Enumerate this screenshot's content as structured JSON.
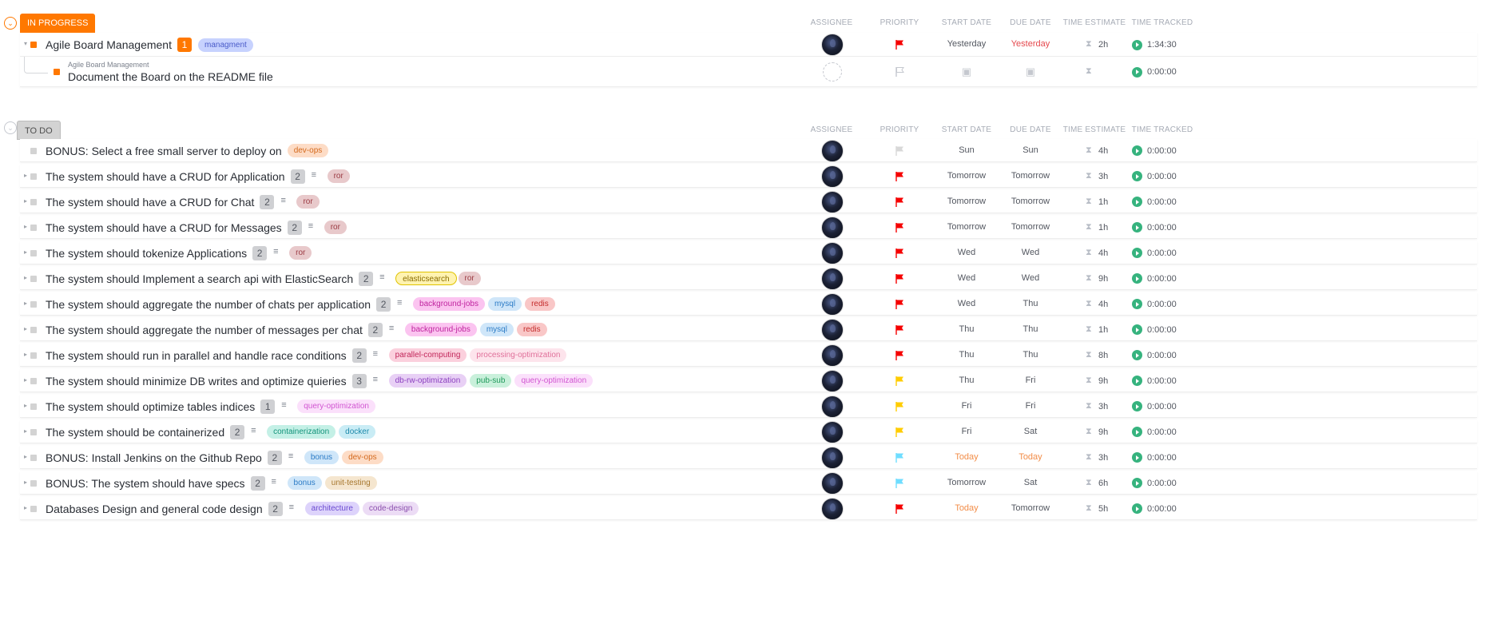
{
  "columns": {
    "assignee": "ASSIGNEE",
    "priority": "PRIORITY",
    "start_date": "START DATE",
    "due_date": "DUE DATE",
    "time_estimate": "TIME ESTIMATE",
    "time_tracked": "TIME TRACKED"
  },
  "colors": {
    "in_progress": "#ff7800",
    "todo": "#d3d3d3",
    "urgent_flag": "#f50000",
    "high_flag": "#ffcc00",
    "low_flag": "#6fddff",
    "none_flag": "#d8d8d8",
    "overdue": "#e5484d",
    "today": "#f28d48"
  },
  "groups": [
    {
      "status": "IN PROGRESS",
      "tasks": [
        {
          "title": "Agile Board Management",
          "subtask_count": "1",
          "tags": [
            {
              "label": "managment",
              "bg": "#c7d2fe",
              "fg": "#4a5bc9"
            }
          ],
          "assignee": "avatar",
          "priority": "urgent",
          "start": "Yesterday",
          "due": "Yesterday",
          "due_color": "overdue",
          "estimate": "2h",
          "tracked": "1:34:30"
        },
        {
          "parent": "Agile Board Management",
          "title": "Document the Board on the README file",
          "assignee": "empty",
          "priority": "empty",
          "tracked": "0:00:00"
        }
      ]
    },
    {
      "status": "TO DO",
      "tasks": [
        {
          "title": "BONUS: Select a free small server to deploy on",
          "tags": [
            {
              "label": "dev-ops",
              "bg": "#fddcc6",
              "fg": "#d46a1e"
            }
          ],
          "priority": "none",
          "start": "Sun",
          "due": "Sun",
          "estimate": "4h",
          "tracked": "0:00:00"
        },
        {
          "title": "The system should have a CRUD for Application",
          "subtask_count": "2",
          "tags": [
            {
              "label": "ror",
              "bg": "#e8c9cb",
              "fg": "#9b3a42"
            }
          ],
          "priority": "urgent",
          "start": "Tomorrow",
          "due": "Tomorrow",
          "estimate": "3h",
          "tracked": "0:00:00"
        },
        {
          "title": "The system should have a CRUD for Chat",
          "subtask_count": "2",
          "tags": [
            {
              "label": "ror",
              "bg": "#e8c9cb",
              "fg": "#9b3a42"
            }
          ],
          "priority": "urgent",
          "start": "Tomorrow",
          "due": "Tomorrow",
          "estimate": "1h",
          "tracked": "0:00:00"
        },
        {
          "title": "The system should have a CRUD for Messages",
          "subtask_count": "2",
          "tags": [
            {
              "label": "ror",
              "bg": "#e8c9cb",
              "fg": "#9b3a42"
            }
          ],
          "priority": "urgent",
          "start": "Tomorrow",
          "due": "Tomorrow",
          "estimate": "1h",
          "tracked": "0:00:00"
        },
        {
          "title": "The system should tokenize Applications",
          "subtask_count": "2",
          "tags": [
            {
              "label": "ror",
              "bg": "#e8c9cb",
              "fg": "#9b3a42"
            }
          ],
          "priority": "urgent",
          "start": "Wed",
          "due": "Wed",
          "estimate": "4h",
          "tracked": "0:00:00"
        },
        {
          "title": "The system should Implement a search api with ElasticSearch",
          "subtask_count": "2",
          "tags": [
            {
              "label": "elasticsearch",
              "bg": "#fff3b0",
              "fg": "#8a6d00",
              "border": "#e0c300"
            },
            {
              "label": "ror",
              "bg": "#e8c9cb",
              "fg": "#9b3a42"
            }
          ],
          "priority": "urgent",
          "start": "Wed",
          "due": "Wed",
          "estimate": "9h",
          "tracked": "0:00:00"
        },
        {
          "title": "The system should aggregate the number of chats per application",
          "subtask_count": "2",
          "tags": [
            {
              "label": "background-jobs",
              "bg": "#fbc4f0",
              "fg": "#c0249f"
            },
            {
              "label": "mysql",
              "bg": "#cfe6f9",
              "fg": "#2b7bc6"
            },
            {
              "label": "redis",
              "bg": "#f9c7c7",
              "fg": "#c42b2b"
            }
          ],
          "priority": "urgent",
          "start": "Wed",
          "due": "Thu",
          "estimate": "4h",
          "tracked": "0:00:00"
        },
        {
          "title": "The system should aggregate the number of messages per chat",
          "subtask_count": "2",
          "tags": [
            {
              "label": "background-jobs",
              "bg": "#fbc4f0",
              "fg": "#c0249f"
            },
            {
              "label": "mysql",
              "bg": "#cfe6f9",
              "fg": "#2b7bc6"
            },
            {
              "label": "redis",
              "bg": "#f9c7c7",
              "fg": "#c42b2b"
            }
          ],
          "priority": "urgent",
          "start": "Thu",
          "due": "Thu",
          "estimate": "1h",
          "tracked": "0:00:00"
        },
        {
          "title": "The system should run in parallel and handle race conditions",
          "subtask_count": "2",
          "tags": [
            {
              "label": "parallel-computing",
              "bg": "#fbd0dd",
              "fg": "#c2265a"
            },
            {
              "label": "processing-optimization",
              "bg": "#fde4ec",
              "fg": "#e0709a"
            }
          ],
          "priority": "urgent",
          "start": "Thu",
          "due": "Thu",
          "estimate": "8h",
          "tracked": "0:00:00"
        },
        {
          "title": "The system should minimize DB writes and optimize quieries",
          "subtask_count": "3",
          "tags": [
            {
              "label": "db-rw-optimization",
              "bg": "#e8d0f5",
              "fg": "#8b3fbf"
            },
            {
              "label": "pub-sub",
              "bg": "#c9f0db",
              "fg": "#1f9a5a"
            },
            {
              "label": "query-optimization",
              "bg": "#fbe0fb",
              "fg": "#d155d1"
            }
          ],
          "priority": "high",
          "start": "Thu",
          "due": "Fri",
          "estimate": "9h",
          "tracked": "0:00:00"
        },
        {
          "title": "The system should optimize tables indices",
          "subtask_count": "1",
          "tags": [
            {
              "label": "query-optimization",
              "bg": "#fbe0fb",
              "fg": "#d155d1"
            }
          ],
          "priority": "high",
          "start": "Fri",
          "due": "Fri",
          "estimate": "3h",
          "tracked": "0:00:00"
        },
        {
          "title": "The system should be containerized",
          "subtask_count": "2",
          "tags": [
            {
              "label": "containerization",
              "bg": "#c4f0e6",
              "fg": "#12937a"
            },
            {
              "label": "docker",
              "bg": "#c9ecf5",
              "fg": "#1d8aab"
            }
          ],
          "priority": "high",
          "start": "Fri",
          "due": "Sat",
          "estimate": "9h",
          "tracked": "0:00:00"
        },
        {
          "title": "BONUS: Install Jenkins on the Github Repo",
          "subtask_count": "2",
          "tags": [
            {
              "label": "bonus",
              "bg": "#cfe6f9",
              "fg": "#2b7bc6"
            },
            {
              "label": "dev-ops",
              "bg": "#fddcc6",
              "fg": "#d46a1e"
            }
          ],
          "priority": "low",
          "start": "Today",
          "start_color": "today",
          "due": "Today",
          "due_color": "today",
          "estimate": "3h",
          "tracked": "0:00:00"
        },
        {
          "title": "BONUS: The system should have specs",
          "subtask_count": "2",
          "tags": [
            {
              "label": "bonus",
              "bg": "#cfe6f9",
              "fg": "#2b7bc6"
            },
            {
              "label": "unit-testing",
              "bg": "#f5e6cf",
              "fg": "#a6762d"
            }
          ],
          "priority": "low",
          "start": "Tomorrow",
          "due": "Sat",
          "estimate": "6h",
          "tracked": "0:00:00"
        },
        {
          "title": "Databases Design and general code design",
          "subtask_count": "2",
          "tags": [
            {
              "label": "architecture",
              "bg": "#ddd3fb",
              "fg": "#6b4ad1"
            },
            {
              "label": "code-design",
              "bg": "#ecdcf5",
              "fg": "#8b4fae"
            }
          ],
          "priority": "urgent",
          "start": "Today",
          "start_color": "today",
          "due": "Tomorrow",
          "estimate": "5h",
          "tracked": "0:00:00"
        }
      ]
    }
  ]
}
